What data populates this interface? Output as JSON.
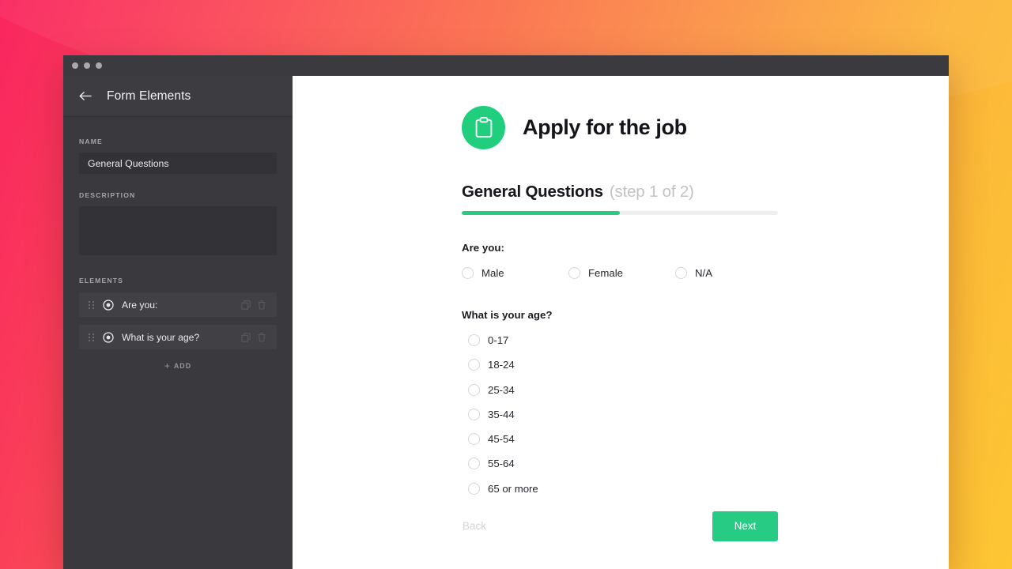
{
  "window": {
    "titlebar_dots": [
      "dot",
      "dot",
      "dot"
    ]
  },
  "sidebar": {
    "back_icon": "arrow-left-icon",
    "title": "Form Elements",
    "name_field": {
      "label": "NAME",
      "value": "General Questions",
      "placeholder": ""
    },
    "description_field": {
      "label": "DESCRIPTION",
      "value": "",
      "placeholder": ""
    },
    "elements_label": "ELEMENTS",
    "elements": [
      {
        "name": "Are you:",
        "type_icon": "radio-button-icon",
        "drag_icon": "drag-handle-icon",
        "copy_icon": "copy-icon",
        "delete_icon": "trash-icon"
      },
      {
        "name": "What is your age?",
        "type_icon": "radio-button-icon",
        "drag_icon": "drag-handle-icon",
        "copy_icon": "copy-icon",
        "delete_icon": "trash-icon"
      }
    ],
    "add_button": {
      "plus": "+",
      "label": "ADD"
    }
  },
  "form": {
    "logo_icon": "clipboard-icon",
    "title": "Apply for the job",
    "step_name": "General Questions",
    "step_counter": "(step 1 of 2)",
    "progress_percent": 50,
    "questions": [
      {
        "label": "Are you:",
        "layout": "inline",
        "options": [
          "Male",
          "Female",
          "N/A"
        ]
      },
      {
        "label": "What is your age?",
        "layout": "list",
        "options": [
          "0-17",
          "18-24",
          "25-34",
          "35-44",
          "45-54",
          "55-64",
          "65 or more"
        ]
      }
    ],
    "back_label": "Back",
    "next_label": "Next"
  },
  "colors": {
    "accent_green": "#27CB84",
    "logo_green": "#21CE7D",
    "sidebar_bg": "#3a3a3e",
    "sidebar_header_bg": "#3d3d41",
    "input_bg": "#333337",
    "element_row_bg": "#414145",
    "titlebar_bg": "#3b3b3f",
    "gradient_start": "#F9255F",
    "gradient_mid": "#FB9544",
    "gradient_end": "#FDC633",
    "progress_track": "#eeeeef",
    "muted_text": "#c2c2c6"
  }
}
